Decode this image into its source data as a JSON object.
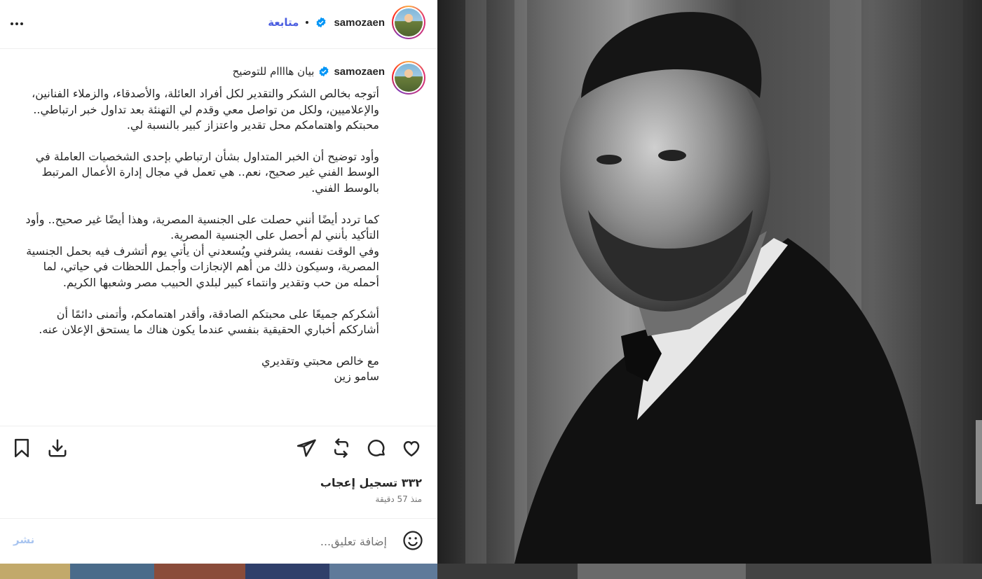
{
  "header": {
    "username": "samozaen",
    "follow_label": "متابعة",
    "more_icon": "more-horizontal-icon"
  },
  "caption": {
    "username": "samozaen",
    "title": "بيان هاااام للتوضيح",
    "paragraphs": [
      "أتوجه بخالص الشكر والتقدير لكل أفراد العائلة، والأصدقاء، والزملاء الفنانين، والإعلاميين، ولكل من تواصل معي وقدم لي التهنئة بعد تداول خبر ارتباطي.. محبتكم واهتمامكم محل تقدير واعتزاز كبير بالنسبة لي.",
      "وأود توضيح أن الخبر المتداول بشأن ارتباطي بإحدى الشخصيات العاملة في الوسط الفني غير صحيح، نعم.. هي تعمل في مجال إدارة الأعمال المرتبط بالوسط الفني.",
      "كما تردد أيضًا أنني حصلت على الجنسية المصرية، وهذا أيضًا غير صحيح.. وأود التأكيد بأنني لم أحصل على الجنسية المصرية.",
      "وفي الوقت نفسه، يشرفني ويُسعدني أن يأتي يوم أتشرف فيه بحمل الجنسية المصرية، وسيكون ذلك من أهم الإنجازات وأجمل اللحظات في حياتي، لما أحمله من حب وتقدير وانتماء كبير لبلدي الحبيب مصر وشعبها الكريم.",
      "أشكركم جميعًا على محبتكم الصادقة، وأقدر اهتمامكم، وأتمنى دائمًا أن أشارككم أخباري الحقيقية بنفسي عندما يكون هناك ما يستحق الإعلان عنه.",
      "مع خالص محبتي وتقديري",
      "سامو زين"
    ]
  },
  "actions": {
    "like_icon": "heart-icon",
    "comment_icon": "comment-icon",
    "repost_icon": "repost-icon",
    "share_icon": "send-icon",
    "download_icon": "download-icon",
    "save_icon": "bookmark-icon",
    "likes_text": "٣٣٢ تسجيل إعجاب",
    "time_text": "منذ 57 دقيقة"
  },
  "comment": {
    "placeholder": "إضافة تعليق...",
    "post_label": "نشر",
    "emoji_icon": "emoji-icon"
  },
  "colors": {
    "follow": "#4a5de0",
    "verified": "#0095f6",
    "post_disabled": "#a9c5f0"
  }
}
